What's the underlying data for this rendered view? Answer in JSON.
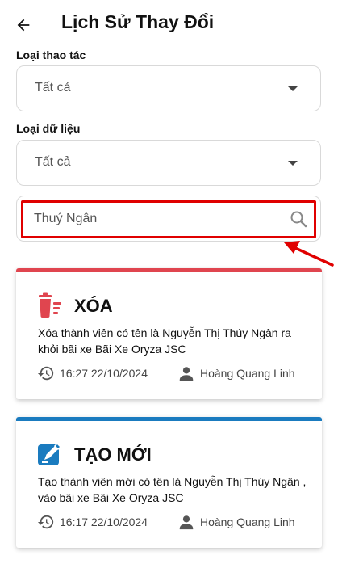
{
  "header": {
    "title": "Lịch Sử Thay Đổi"
  },
  "filters": {
    "action_type": {
      "label": "Loại thao tác",
      "value": "Tất cả"
    },
    "data_type": {
      "label": "Loại dữ liệu",
      "value": "Tất cả"
    },
    "search": {
      "value": "Thuý Ngân"
    }
  },
  "colors": {
    "delete_accent": "#e0454f",
    "create_accent": "#1a7bbf",
    "highlight": "#e00000"
  },
  "history": [
    {
      "action": "XÓA",
      "icon": "trash-icon",
      "description": "Xóa thành viên có tên là Nguyễn Thị Thúy Ngân ra khỏi bãi xe Bãi Xe Oryza JSC",
      "time": "16:27 22/10/2024",
      "user": "Hoàng Quang Linh"
    },
    {
      "action": "TẠO MỚI",
      "icon": "pencil-create-icon",
      "description": "Tạo thành viên mới có tên là Nguyễn Thị Thúy Ngân , vào bãi xe Bãi Xe Oryza JSC",
      "time": "16:17 22/10/2024",
      "user": "Hoàng Quang Linh"
    }
  ]
}
